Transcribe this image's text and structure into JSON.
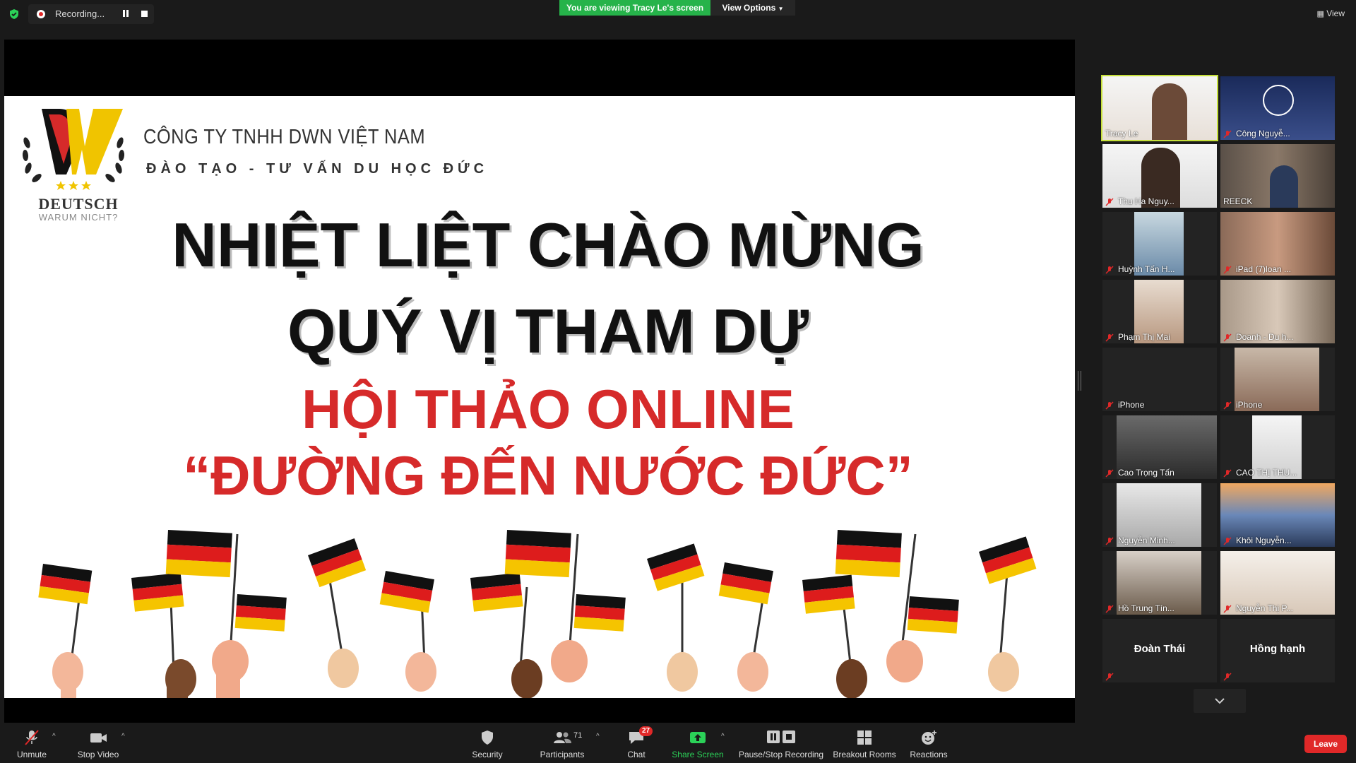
{
  "top_bar": {
    "recording_label": "Recording...",
    "viewing_banner": "You are viewing Tracy Le's screen",
    "view_options_label": "View Options",
    "view_label": "View"
  },
  "slide": {
    "company_name": "CÔNG TY TNHH DWN VIỆT NAM",
    "tagline": "ĐÀO TẠO - TƯ VẤN DU HỌC ĐỨC",
    "logo_word": "DEUTSCH",
    "logo_subtitle": "WARUM NICHT?",
    "title_line1": "NHIỆT LIỆT CHÀO MỪNG",
    "title_line2": "QUÝ  VỊ THAM DỰ",
    "title_line3": "HỘI THẢO ONLINE",
    "title_line4": "“ĐƯỜNG ĐẾN NƯỚC ĐỨC”"
  },
  "participants": [
    {
      "name": "Tracy Le",
      "muted": false,
      "active": true
    },
    {
      "name": "Công Nguyễ...",
      "muted": true
    },
    {
      "name": "Thu Ha Nguy...",
      "muted": true
    },
    {
      "name": "REECK",
      "muted": false
    },
    {
      "name": "Huỳnh Tấn H...",
      "muted": true
    },
    {
      "name": "iPad (7)loan ...",
      "muted": true
    },
    {
      "name": "Phạm Thị Mai",
      "muted": true
    },
    {
      "name": "Doanh - Du h...",
      "muted": true
    },
    {
      "name": "iPhone",
      "muted": true
    },
    {
      "name": "iPhone",
      "muted": true
    },
    {
      "name": "Cao Trọng Tấn",
      "muted": true
    },
    {
      "name": "CAO THỊ THU...",
      "muted": true
    },
    {
      "name": "Nguyễn Minh...",
      "muted": true
    },
    {
      "name": "Khôi Nguyễn...",
      "muted": true
    },
    {
      "name": "Hồ Trung Tín...",
      "muted": true
    },
    {
      "name": "Nguyễn Thị P...",
      "muted": true
    },
    {
      "name": "Đoàn Thái",
      "muted": true
    },
    {
      "name": "Hồng hạnh",
      "muted": true
    }
  ],
  "toolbar": {
    "unmute": "Unmute",
    "stop_video": "Stop Video",
    "security": "Security",
    "participants": "Participants",
    "participants_count": "71",
    "chat": "Chat",
    "chat_badge": "27",
    "share_screen": "Share Screen",
    "pause_stop_recording": "Pause/Stop Recording",
    "breakout_rooms": "Breakout Rooms",
    "reactions": "Reactions",
    "leave": "Leave"
  },
  "colors": {
    "accent_green": "#26b34a",
    "leave_red": "#e02828",
    "slide_red": "#d62a2a",
    "active_speaker": "#c6e03a"
  }
}
